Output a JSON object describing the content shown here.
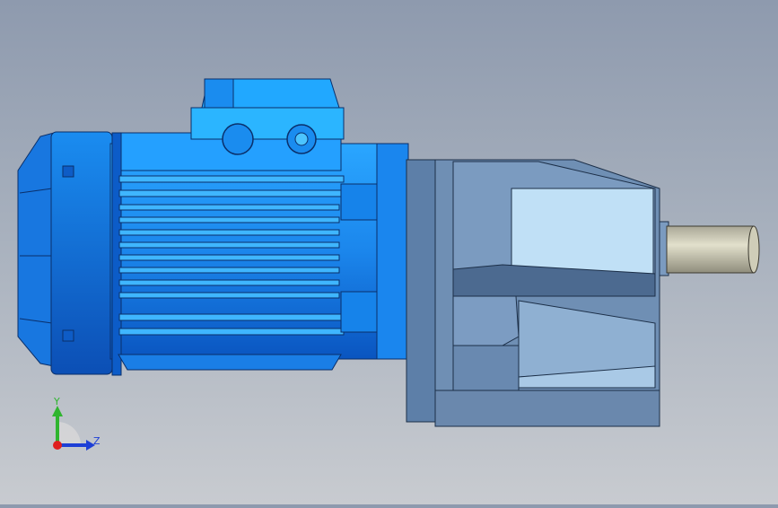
{
  "viewport": {
    "background_top": "#8e9aae",
    "background_bottom": "#c8cbd0"
  },
  "model": {
    "parts": [
      "motor-fan-cover",
      "motor-body",
      "terminal-box",
      "gearbox-housing",
      "output-shaft"
    ],
    "colors": {
      "motor": "#1f8cf0",
      "motor_dark": "#0a4fb8",
      "motor_light": "#4cc4ff",
      "gearbox": "#6f8fb4",
      "gearbox_dark": "#4c6a90",
      "gearbox_light": "#b9d9f2",
      "shaft": "#cfcdb8"
    }
  },
  "triad": {
    "y_label": "Y",
    "z_label": "Z",
    "y_color": "#2fb52f",
    "z_color": "#1d3fd6",
    "x_color": "#e01f1f"
  }
}
